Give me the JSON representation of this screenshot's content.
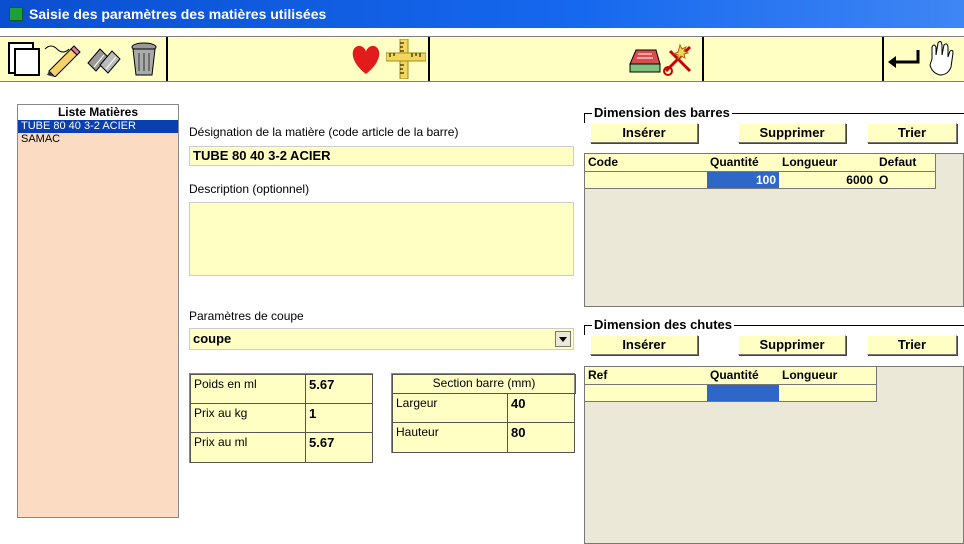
{
  "window": {
    "title": "Saisie des paramètres des matières utilisées"
  },
  "toolbar": {
    "icons": [
      "new-document-icon",
      "edit-pencil-icon",
      "copy-icon",
      "trash-icon",
      "favorite-heart-icon",
      "ruler-icon",
      "calculator-print-icon",
      "cut-icon",
      "return-arrow-icon",
      "exit-hand-icon"
    ]
  },
  "list": {
    "header": "Liste Matières",
    "items": [
      "TUBE 80 40 3-2 ACIER",
      "SAMAC"
    ]
  },
  "form": {
    "designation_label": "Désignation de la matière (code article de la barre)",
    "designation_value": "TUBE 80 40 3-2 ACIER",
    "description_label": "Description (optionnel)",
    "description_value": "",
    "coupe_label": "Paramètres de coupe",
    "coupe_value": "coupe"
  },
  "prices": {
    "poids_label": "Poids en ml",
    "poids_value": "5.67",
    "prix_kg_label": "Prix au kg",
    "prix_kg_value": "1",
    "prix_ml_label": "Prix au ml",
    "prix_ml_value": "5.67"
  },
  "section": {
    "title": "Section barre (mm)",
    "largeur_label": "Largeur",
    "largeur_value": "40",
    "hauteur_label": "Hauteur",
    "hauteur_value": "80"
  },
  "barres": {
    "title": "Dimension des barres",
    "insert": "Insérer",
    "delete": "Supprimer",
    "sort": "Trier",
    "columns": [
      "Code",
      "Quantité",
      "Longueur",
      "Defaut"
    ],
    "rows": [
      {
        "code": "",
        "quantite": "100",
        "longueur": "6000",
        "defaut": "O"
      }
    ]
  },
  "chutes": {
    "title": "Dimension des chutes",
    "insert": "Insérer",
    "delete": "Supprimer",
    "sort": "Trier",
    "columns": [
      "Ref",
      "Quantité",
      "Longueur"
    ],
    "rows": [
      {
        "ref": "",
        "quantite": "",
        "longueur": ""
      }
    ]
  }
}
